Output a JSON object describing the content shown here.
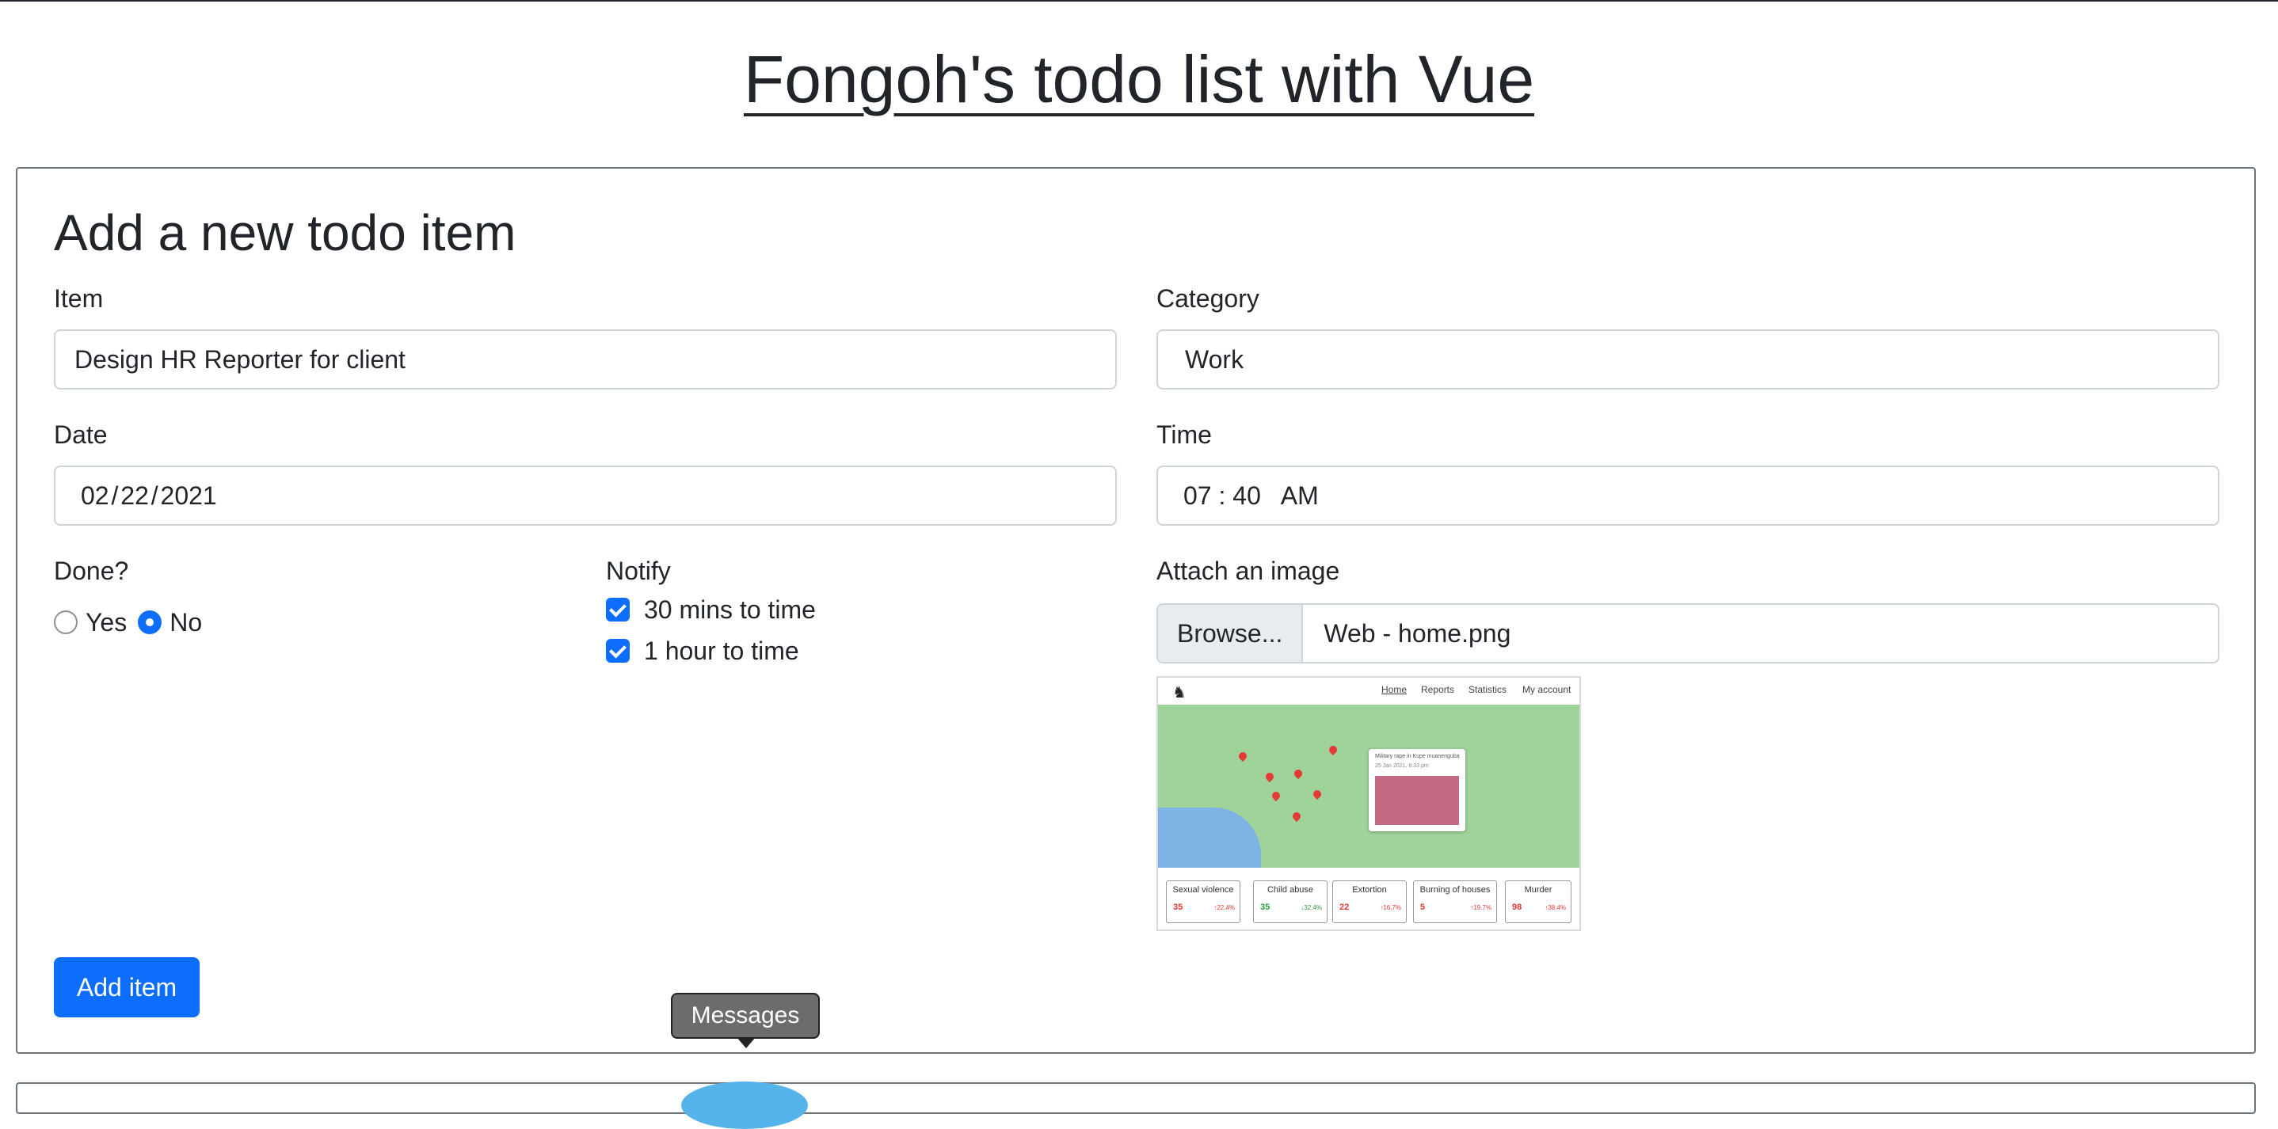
{
  "header": {
    "title": "Fongoh's todo list with Vue"
  },
  "form": {
    "heading": "Add a new todo item",
    "item": {
      "label": "Item",
      "value": "Design HR Reporter for client"
    },
    "category": {
      "label": "Category",
      "value": "Work"
    },
    "date": {
      "label": "Date",
      "value": "02 / 22 / 2021"
    },
    "time": {
      "label": "Time",
      "value": "07 : 40   AM"
    },
    "done": {
      "label": "Done?",
      "options": [
        {
          "label": "Yes",
          "checked": false
        },
        {
          "label": "No",
          "checked": true
        }
      ]
    },
    "notify": {
      "label": "Notify",
      "options": [
        {
          "label": "30 mins to time",
          "checked": true
        },
        {
          "label": "1 hour to time",
          "checked": true
        }
      ]
    },
    "attach": {
      "label": "Attach an image",
      "browse_label": "Browse...",
      "file_name": "Web - home.png"
    },
    "preview": {
      "nav": [
        "Home",
        "Reports",
        "Statistics",
        "My account"
      ],
      "popup": {
        "title": "Military rape in Kupe muanenguba",
        "date": "25 Jan 2021, 8:33 pm"
      },
      "stats": [
        {
          "name": "Sexual violence",
          "value": "35",
          "change": "↑22.4%",
          "trend": "up"
        },
        {
          "name": "Child abuse",
          "value": "35",
          "change": "↓32.4%",
          "trend": "down"
        },
        {
          "name": "Extortion",
          "value": "22",
          "change": "↑16.7%",
          "trend": "up"
        },
        {
          "name": "Burning of houses",
          "value": "5",
          "change": "↑19.7%",
          "trend": "up"
        },
        {
          "name": "Murder",
          "value": "98",
          "change": "↑38.4%",
          "trend": "up"
        }
      ]
    },
    "submit_label": "Add item"
  },
  "tooltip": {
    "text": "Messages"
  }
}
